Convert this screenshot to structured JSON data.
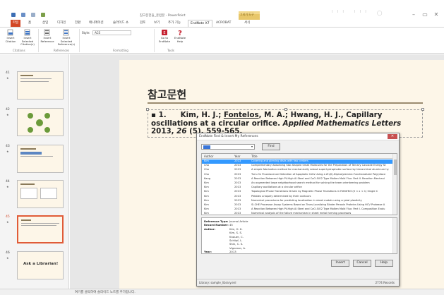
{
  "titlebar": {
    "title": "참고문헌들_훈련본 - PowerPoint",
    "context_tab_group": "그리기 도구",
    "minimize": "–",
    "restore": "▭",
    "close": "✕"
  },
  "tabs": [
    {
      "label": "파일",
      "kind": "file"
    },
    {
      "label": "홈"
    },
    {
      "label": "삽입"
    },
    {
      "label": "디자인"
    },
    {
      "label": "전환"
    },
    {
      "label": "애니메이션"
    },
    {
      "label": "슬라이드 쇼"
    },
    {
      "label": "검토"
    },
    {
      "label": "보기"
    },
    {
      "label": "추가 기능"
    },
    {
      "label": "EndNote X7",
      "kind": "active"
    },
    {
      "label": "ACROBAT"
    },
    {
      "label": "서식"
    }
  ],
  "ribbon": {
    "insert_citation": "Insert Citation",
    "insert_selected_citations": "Insert Selected Citation(s)",
    "insert_reference": "Insert Reference",
    "insert_selected_references": "Insert Selected Reference(s)",
    "style_label": "Style:",
    "style_value": "ACS",
    "go_to_endnote": "Go to EndNote",
    "endnote_help": "EndNote Help",
    "group_citations": "Citations",
    "group_references": "References",
    "group_formatting": "Formatting",
    "group_tools": "Tools"
  },
  "thumbnails": [
    {
      "num": "41",
      "title": ""
    },
    {
      "num": "42",
      "title": ""
    },
    {
      "num": "43",
      "title": ""
    },
    {
      "num": "44",
      "title": ""
    },
    {
      "num": "45",
      "title": "",
      "selected": true
    },
    {
      "num": "46",
      "title": "Ask a Librarian!"
    }
  ],
  "slide": {
    "title": "참고문헌",
    "ref_number": "1.",
    "ref_authors_pre": "Kim, H. J.; ",
    "ref_author_underlined": "Fontelos",
    "ref_authors_post": ", M. A.; Hwang, H. J., Capillary oscillations at a circular orifice. ",
    "ref_journal": "Applied Mathematics Letters",
    "ref_year": " 2013, ",
    "ref_volume": "26",
    "ref_pages": " (5), 559-565."
  },
  "dialog": {
    "title": "EndNote Find & Insert My References",
    "find_button": "Find",
    "columns": {
      "author": "Author",
      "year": "Year",
      "title": "Title"
    },
    "rows": [
      {
        "author": "Kim",
        "year": "2013",
        "title": "Covering and piercing disks with two centers",
        "selected": true
      },
      {
        "author": "Cho",
        "year": "2013",
        "title": "Complementary Absorbing Star-Shaped Small Molecules for the Preparation of Ternary Cascade Energy St"
      },
      {
        "author": "Cho",
        "year": "2013",
        "title": "A simple fabrication method for mechanically robust superhydrophobic surface by hierarchical aluminum hy"
      },
      {
        "author": "Cho",
        "year": "2013",
        "title": "Turn-On Fluorescence Detection of Apoptotic Cells Using a Zn(II)-Dipicolylamine-Functionalized Poly(diace"
      },
      {
        "author": "Kang",
        "year": "2013",
        "title": "A Reaction Between High Pt-High Al Steel and CaO-SiO2 Type Molten Mold Flux: Part II. Reaction Mechani"
      },
      {
        "author": "Kim",
        "year": "2013",
        "title": "An augmented large neighborhood search method for solving the team orienteering problem"
      },
      {
        "author": "Kim",
        "year": "2013",
        "title": "Capillary oscillations at a circular orifice"
      },
      {
        "author": "Kim",
        "year": "2013",
        "title": "Topological Phase Transitions Driven by Magnetic Phase Transitions in FeBiXTe3 (0 < x < 1) Single C"
      },
      {
        "author": "Kim",
        "year": "2013",
        "title": "Pebbles uniquely determined by their contours"
      },
      {
        "author": "Kim",
        "year": "2013",
        "title": "Numerical procedures for predicting localization in sheet metals using crystal plasticity"
      },
      {
        "author": "Kim",
        "year": "2013",
        "title": "Si-CHE Processor Assay Systems Based on Trans-Localizing Binder Peroxin Proteins Using HCV Protease A"
      },
      {
        "author": "Kim",
        "year": "2013",
        "title": "A Reaction Between High Pt-High Al Steel and CaO-SiO2 Type Molten Mold Flux: Part I. Composition Evolu"
      },
      {
        "author": "Kim",
        "year": "2013",
        "title": "Numerical analysis of the failure mechanism in sheet metal forming processes"
      }
    ],
    "detail": [
      {
        "key": "Reference Type:",
        "value": "Journal Article"
      },
      {
        "key": "Record Number:",
        "value": "45"
      },
      {
        "key": "Author:",
        "value": "Kim, H. K."
      },
      {
        "key": "",
        "value": "Kim, S. S."
      },
      {
        "key": "",
        "value": "Knauer, C."
      },
      {
        "key": "",
        "value": "Schlipf, L."
      },
      {
        "key": "",
        "value": "Shin, C. S."
      },
      {
        "key": "",
        "value": "Vigneron, A."
      },
      {
        "key": "Year:",
        "value": "2013"
      }
    ],
    "buttons": {
      "insert": "Insert",
      "cancel": "Cancel",
      "help": "Help"
    },
    "status_library": "Library: sample_library.enl",
    "status_count": "2774 Records"
  },
  "statusbar": {
    "text": "여기를 클릭하여 슬라이드 노트를 추가합니다."
  },
  "colors": {
    "file_tab": "#d24726",
    "selected_row": "#3399ff",
    "slide_bg": "#fdf6e8",
    "context_band": "#e8c76a"
  }
}
